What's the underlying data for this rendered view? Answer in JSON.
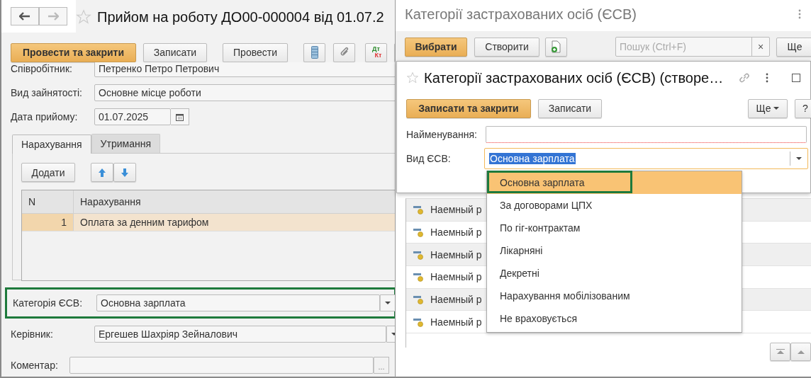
{
  "main_form": {
    "title": "Прийом на роботу ДО00-000004 від 01.07.2",
    "toolbar": {
      "primary": "Провести та закрити",
      "buttons": [
        "Записати",
        "Провести"
      ],
      "debit": "Дт",
      "credit": "Кт"
    },
    "fields": [
      {
        "label": "Співробітник:",
        "value": "Петренко Петро Петрович",
        "kind": "select"
      },
      {
        "label": "Вид зайнятості:",
        "value": "Основне місце роботи",
        "kind": "text"
      },
      {
        "label": "Дата прийому:",
        "value": "01.07.2025",
        "kind": "date"
      }
    ],
    "tabs": [
      {
        "label": "Нарахування",
        "selected": true
      },
      {
        "label": "Утримання",
        "selected": false
      }
    ],
    "add_button": "Додати",
    "table": {
      "columns": [
        "N",
        "Нарахування"
      ],
      "rows": [
        {
          "n": "1",
          "name": "Оплата за денним тарифом",
          "selected": true
        }
      ]
    },
    "category": {
      "label": "Категорія ЄСВ:",
      "value": "Основна зарплата",
      "highlighted": true
    },
    "manager": {
      "label": "Керівник:",
      "value": "Ергешев Шахріяр Зейналович"
    },
    "comment": {
      "label": "Коментар:",
      "button": "..."
    }
  },
  "list_window": {
    "title": "Категорії застрахованих осіб (ЄСВ)",
    "primary": "Вибрати",
    "create": "Створити",
    "search_placeholder": "Пошук (Ctrl+F)",
    "clear": "×",
    "more": "Ще",
    "rows": [
      "Наемный р",
      "Наемный р",
      "Наемный р",
      "Наемный р",
      "Наемный р",
      "Наемный р"
    ]
  },
  "create_window": {
    "title": "Категорії застрахованих осіб (ЄСВ) (створе…",
    "primary": "Записати та закрити",
    "save": "Записати",
    "more": "Ще",
    "help": "?",
    "name_field": {
      "label": "Найменування:",
      "required": true
    },
    "type_field": {
      "label": "Вид ЄСВ:",
      "value": "Основна зарплата",
      "focused": true,
      "text_selected": true
    }
  },
  "dropdown": {
    "items": [
      {
        "label": "Основна зарплата",
        "selected": true,
        "highlighted": true
      },
      {
        "label": "За договорами ЦПХ",
        "selected": false,
        "highlighted": false
      },
      {
        "label": "По гіг-контрактам",
        "selected": false,
        "highlighted": false
      },
      {
        "label": "Лікарняні",
        "selected": false,
        "highlighted": false
      },
      {
        "label": "Декретні",
        "selected": false,
        "highlighted": false
      },
      {
        "label": "Нарахування мобілізованим",
        "selected": false,
        "highlighted": false
      },
      {
        "label": "Не враховується",
        "selected": false,
        "highlighted": false
      }
    ]
  }
}
